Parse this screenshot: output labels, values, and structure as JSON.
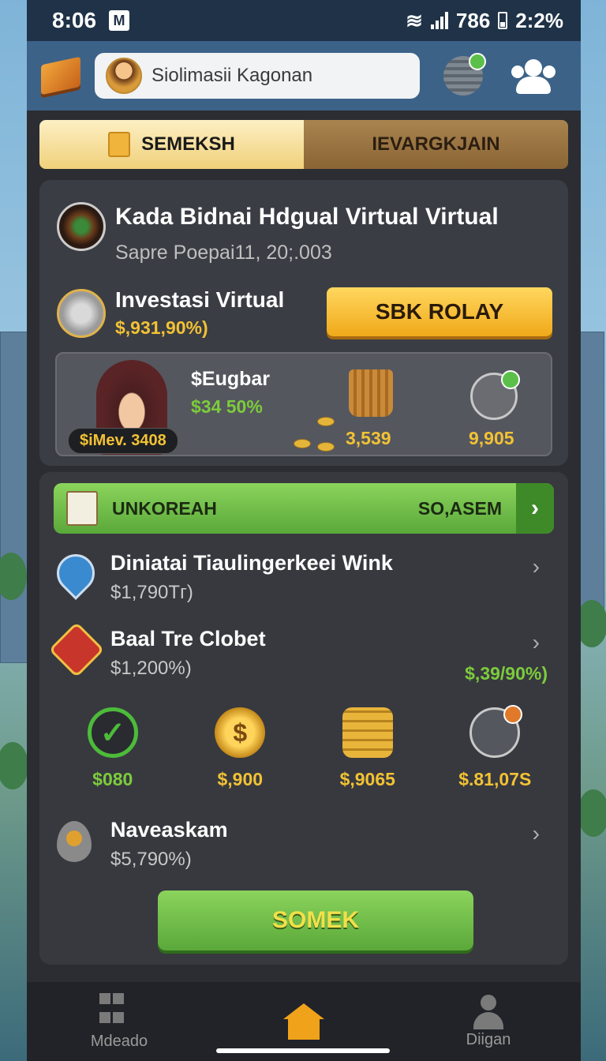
{
  "status_bar": {
    "time": "8:06",
    "notif_badge": "M",
    "network": "786",
    "battery": "2:2%"
  },
  "header": {
    "player_name": "Siolimasii Kagonan",
    "icons": [
      "book-icon",
      "avatar",
      "globe-icon",
      "friends-icon"
    ]
  },
  "tabs": [
    {
      "label": "SEMEKSH",
      "active": true
    },
    {
      "label": "IEVARGKJAIN",
      "active": false
    }
  ],
  "top_card": {
    "title": "Kada Bidnai Hdgual Virtual Virtual",
    "subtitle": "Sapre Poepai11, 20;.003",
    "invest_title": "Investasi Virtual",
    "invest_value": "$,931,90%)",
    "action_button": "SBK ROLAY",
    "person_name": "$Eugbar",
    "person_value": "$34 50%",
    "name_tag": "$iMev. 3408",
    "stat1": "3,539",
    "stat2": "9,905"
  },
  "list_panel": {
    "banner_left": "UNKOREAH",
    "banner_right": "SO,ASEM",
    "items": [
      {
        "title": "Diniatai Tiaulingerkeei Wink",
        "value": "$1,790Тг)"
      },
      {
        "title": "Baal Tre Clobet",
        "value": "$1,200%)",
        "extra": "$,39/90%)"
      },
      {
        "title": "Naveaskam",
        "value": "$5,790%)"
      }
    ],
    "icon_stats": [
      {
        "label": "$080",
        "icon": "check-circle-icon",
        "color": "green"
      },
      {
        "label": "$,900",
        "icon": "gold-coin-icon",
        "color": "gold"
      },
      {
        "label": "$,9065",
        "icon": "coin-stack-icon",
        "color": "gold"
      },
      {
        "label": "$.81,07S",
        "icon": "bell-icon",
        "color": "gold"
      }
    ],
    "primary_button": "SOMEK"
  },
  "bottom_nav": [
    {
      "label": "Mdeado",
      "icon": "grid-icon"
    },
    {
      "label": "",
      "icon": "home-icon"
    },
    {
      "label": "Diigan",
      "icon": "person-icon"
    }
  ],
  "colors": {
    "accent_gold": "#f2c234",
    "accent_green": "#7ccc3c",
    "panel_bg": "#3b3d44",
    "header_bg": "#3c6288"
  }
}
